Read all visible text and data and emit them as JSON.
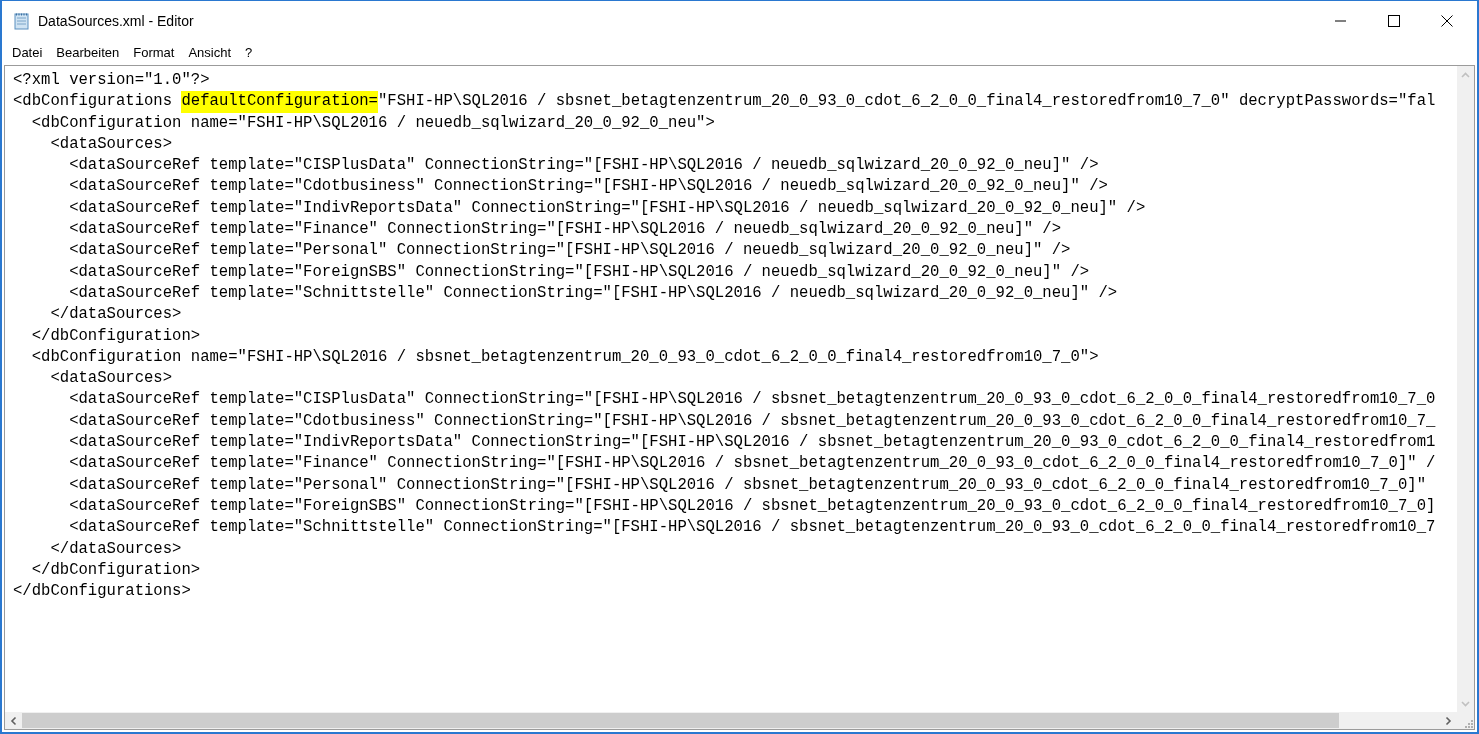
{
  "window": {
    "title": "DataSources.xml - Editor"
  },
  "menu": [
    {
      "label": "Datei"
    },
    {
      "label": "Bearbeiten"
    },
    {
      "label": "Format"
    },
    {
      "label": "Ansicht"
    },
    {
      "label": "?"
    }
  ],
  "editor": {
    "lines": [
      {
        "segments": [
          {
            "text": "<?xml version=\"1.0\"?>",
            "highlighted": false
          }
        ]
      },
      {
        "segments": [
          {
            "text": "<dbConfigurations ",
            "highlighted": false
          },
          {
            "text": "defaultConfiguration=",
            "highlighted": true
          },
          {
            "text": "\"FSHI-HP\\SQL2016 / sbsnet_betagtenzentrum_20_0_93_0_cdot_6_2_0_0_final4_restoredfrom10_7_0\" decryptPasswords=\"fal",
            "highlighted": false
          }
        ]
      },
      {
        "segments": [
          {
            "text": "  <dbConfiguration name=\"FSHI-HP\\SQL2016 / neuedb_sqlwizard_20_0_92_0_neu\">",
            "highlighted": false
          }
        ]
      },
      {
        "segments": [
          {
            "text": "    <dataSources>",
            "highlighted": false
          }
        ]
      },
      {
        "segments": [
          {
            "text": "      <dataSourceRef template=\"CISPlusData\" ConnectionString=\"[FSHI-HP\\SQL2016 / neuedb_sqlwizard_20_0_92_0_neu]\" />",
            "highlighted": false
          }
        ]
      },
      {
        "segments": [
          {
            "text": "      <dataSourceRef template=\"Cdotbusiness\" ConnectionString=\"[FSHI-HP\\SQL2016 / neuedb_sqlwizard_20_0_92_0_neu]\" />",
            "highlighted": false
          }
        ]
      },
      {
        "segments": [
          {
            "text": "      <dataSourceRef template=\"IndivReportsData\" ConnectionString=\"[FSHI-HP\\SQL2016 / neuedb_sqlwizard_20_0_92_0_neu]\" />",
            "highlighted": false
          }
        ]
      },
      {
        "segments": [
          {
            "text": "      <dataSourceRef template=\"Finance\" ConnectionString=\"[FSHI-HP\\SQL2016 / neuedb_sqlwizard_20_0_92_0_neu]\" />",
            "highlighted": false
          }
        ]
      },
      {
        "segments": [
          {
            "text": "      <dataSourceRef template=\"Personal\" ConnectionString=\"[FSHI-HP\\SQL2016 / neuedb_sqlwizard_20_0_92_0_neu]\" />",
            "highlighted": false
          }
        ]
      },
      {
        "segments": [
          {
            "text": "      <dataSourceRef template=\"ForeignSBS\" ConnectionString=\"[FSHI-HP\\SQL2016 / neuedb_sqlwizard_20_0_92_0_neu]\" />",
            "highlighted": false
          }
        ]
      },
      {
        "segments": [
          {
            "text": "      <dataSourceRef template=\"Schnittstelle\" ConnectionString=\"[FSHI-HP\\SQL2016 / neuedb_sqlwizard_20_0_92_0_neu]\" />",
            "highlighted": false
          }
        ]
      },
      {
        "segments": [
          {
            "text": "    </dataSources>",
            "highlighted": false
          }
        ]
      },
      {
        "segments": [
          {
            "text": "  </dbConfiguration>",
            "highlighted": false
          }
        ]
      },
      {
        "segments": [
          {
            "text": "  <dbConfiguration name=\"FSHI-HP\\SQL2016 / sbsnet_betagtenzentrum_20_0_93_0_cdot_6_2_0_0_final4_restoredfrom10_7_0\">",
            "highlighted": false
          }
        ]
      },
      {
        "segments": [
          {
            "text": "    <dataSources>",
            "highlighted": false
          }
        ]
      },
      {
        "segments": [
          {
            "text": "      <dataSourceRef template=\"CISPlusData\" ConnectionString=\"[FSHI-HP\\SQL2016 / sbsnet_betagtenzentrum_20_0_93_0_cdot_6_2_0_0_final4_restoredfrom10_7_0",
            "highlighted": false
          }
        ]
      },
      {
        "segments": [
          {
            "text": "      <dataSourceRef template=\"Cdotbusiness\" ConnectionString=\"[FSHI-HP\\SQL2016 / sbsnet_betagtenzentrum_20_0_93_0_cdot_6_2_0_0_final4_restoredfrom10_7_",
            "highlighted": false
          }
        ]
      },
      {
        "segments": [
          {
            "text": "      <dataSourceRef template=\"IndivReportsData\" ConnectionString=\"[FSHI-HP\\SQL2016 / sbsnet_betagtenzentrum_20_0_93_0_cdot_6_2_0_0_final4_restoredfrom1",
            "highlighted": false
          }
        ]
      },
      {
        "segments": [
          {
            "text": "      <dataSourceRef template=\"Finance\" ConnectionString=\"[FSHI-HP\\SQL2016 / sbsnet_betagtenzentrum_20_0_93_0_cdot_6_2_0_0_final4_restoredfrom10_7_0]\" /",
            "highlighted": false
          }
        ]
      },
      {
        "segments": [
          {
            "text": "      <dataSourceRef template=\"Personal\" ConnectionString=\"[FSHI-HP\\SQL2016 / sbsnet_betagtenzentrum_20_0_93_0_cdot_6_2_0_0_final4_restoredfrom10_7_0]\"",
            "highlighted": false
          }
        ]
      },
      {
        "segments": [
          {
            "text": "      <dataSourceRef template=\"ForeignSBS\" ConnectionString=\"[FSHI-HP\\SQL2016 / sbsnet_betagtenzentrum_20_0_93_0_cdot_6_2_0_0_final4_restoredfrom10_7_0]",
            "highlighted": false
          }
        ]
      },
      {
        "segments": [
          {
            "text": "      <dataSourceRef template=\"Schnittstelle\" ConnectionString=\"[FSHI-HP\\SQL2016 / sbsnet_betagtenzentrum_20_0_93_0_cdot_6_2_0_0_final4_restoredfrom10_7",
            "highlighted": false
          }
        ]
      },
      {
        "segments": [
          {
            "text": "    </dataSources>",
            "highlighted": false
          }
        ]
      },
      {
        "segments": [
          {
            "text": "  </dbConfiguration>",
            "highlighted": false
          }
        ]
      },
      {
        "segments": [
          {
            "text": "</dbConfigurations>",
            "highlighted": false
          }
        ]
      }
    ]
  }
}
